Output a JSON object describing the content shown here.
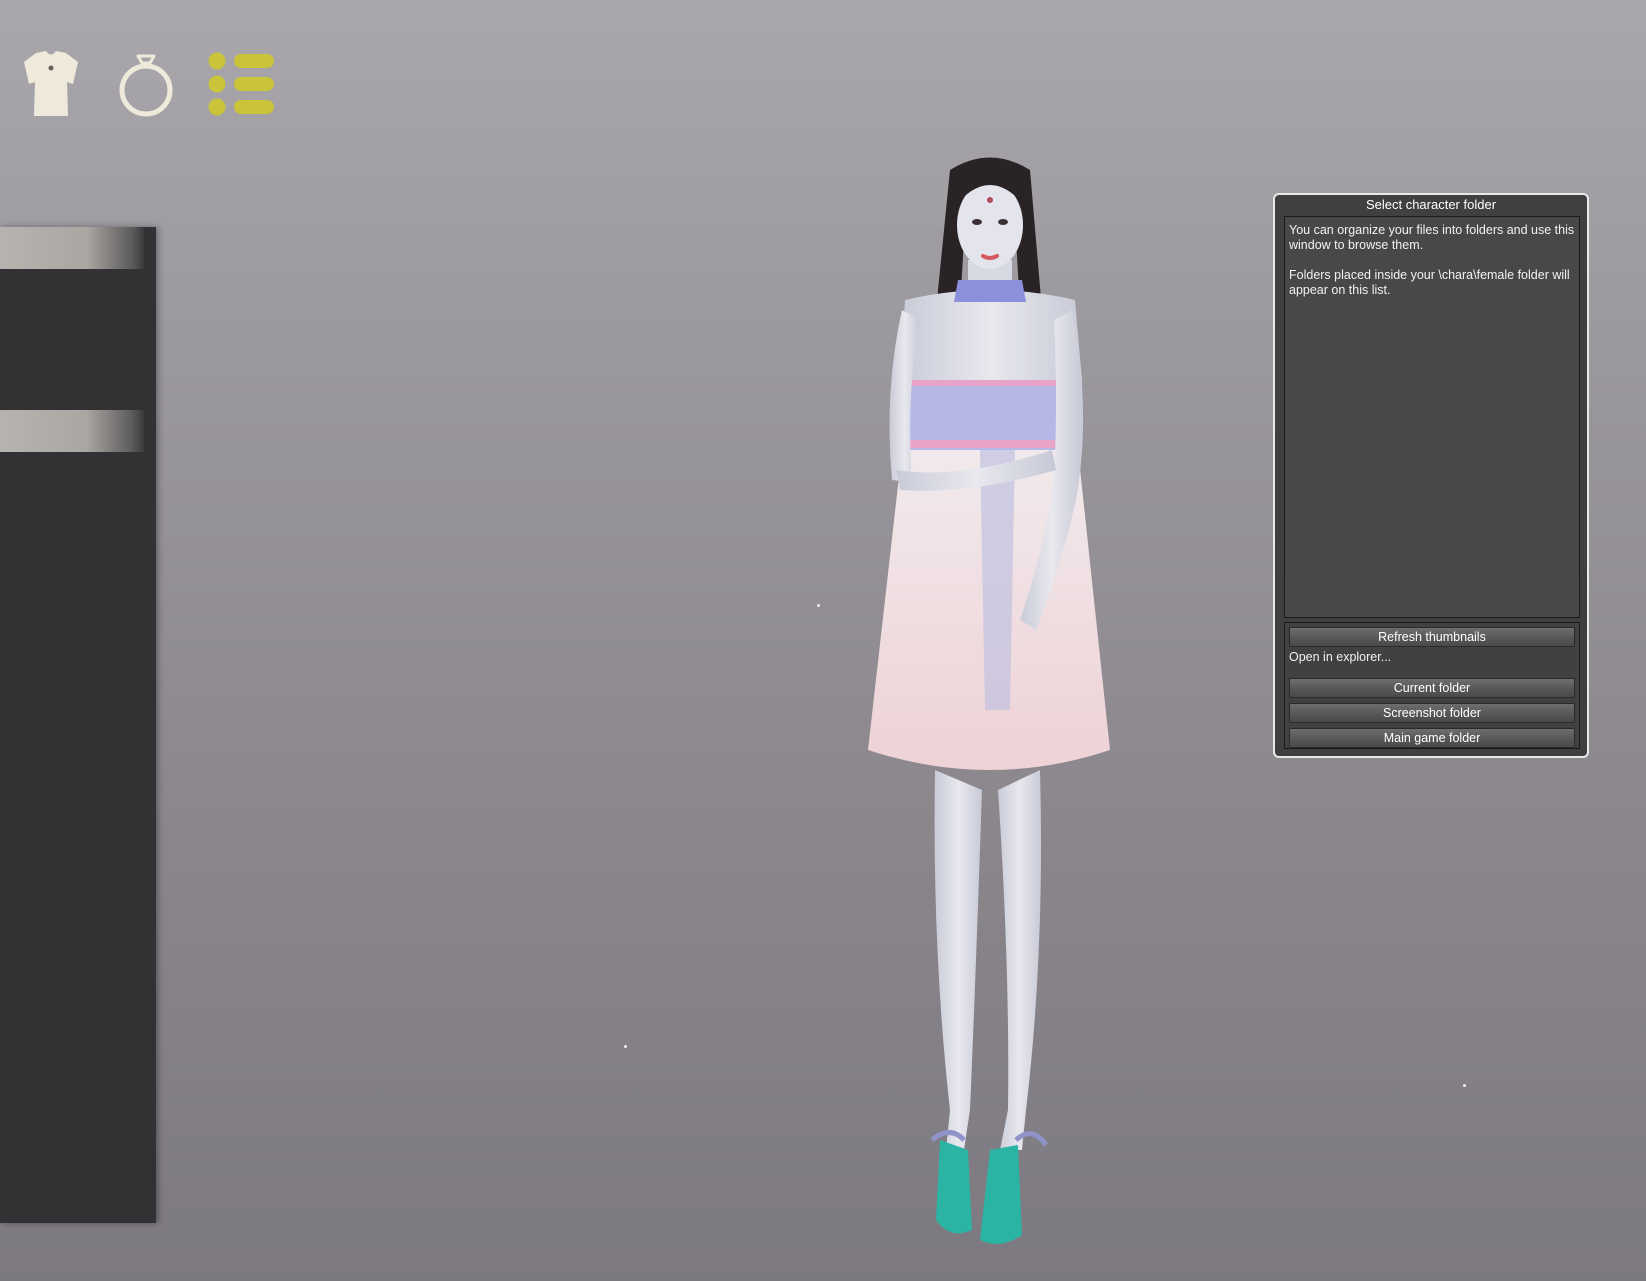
{
  "toolbar": {
    "icons": [
      "shirt-icon",
      "ring-icon",
      "list-icon"
    ],
    "accent_color": "#c9c43a",
    "icon_color": "#efe9dc"
  },
  "folder_window": {
    "title": "Select character folder",
    "description_line1": "You can organize your files into folders and use this window to browse them.",
    "description_line2": "Folders placed inside your \\chara\\female folder will appear on this list.",
    "refresh_label": "Refresh thumbnails",
    "open_in_explorer_label": "Open in explorer...",
    "current_folder_label": "Current folder",
    "screenshot_folder_label": "Screenshot folder",
    "main_game_folder_label": "Main game folder"
  }
}
